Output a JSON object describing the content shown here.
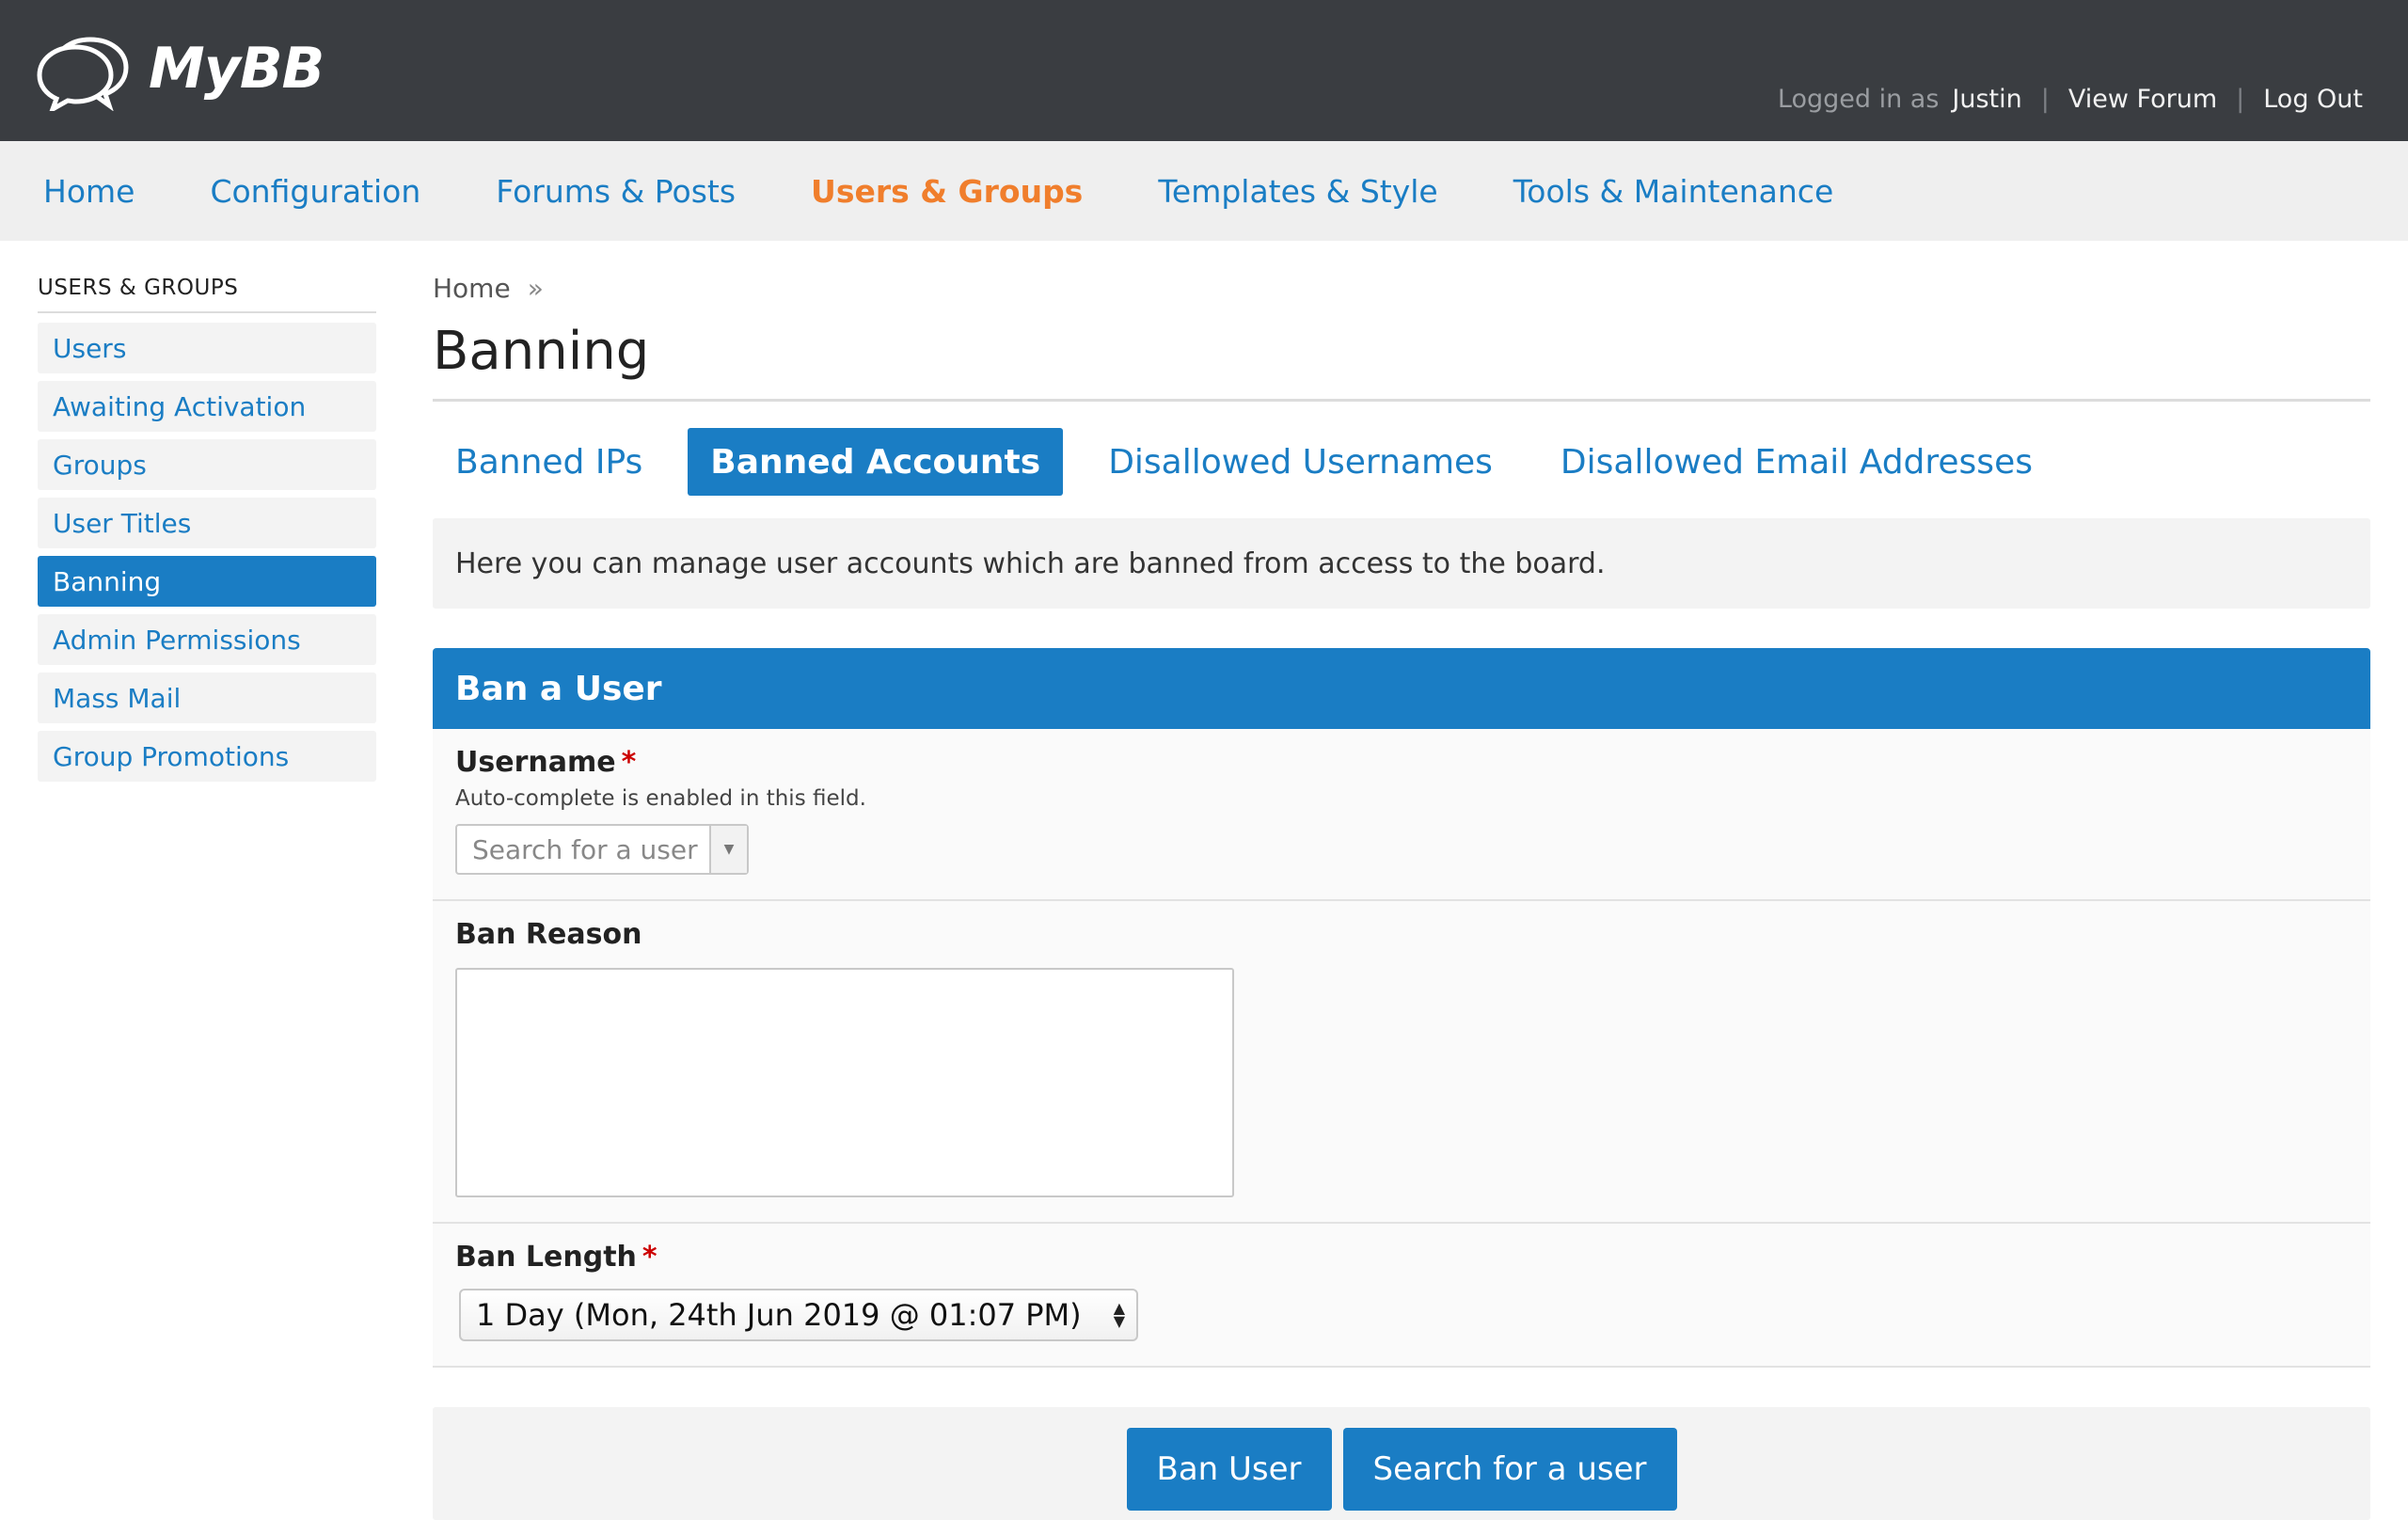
{
  "app": {
    "logo_text": "MyBB"
  },
  "header": {
    "logged_in_label": "Logged in as",
    "username": "Justin",
    "view_forum": "View Forum",
    "log_out": "Log Out"
  },
  "topnav": {
    "items": [
      {
        "label": "Home",
        "active": false
      },
      {
        "label": "Configuration",
        "active": false
      },
      {
        "label": "Forums & Posts",
        "active": false
      },
      {
        "label": "Users & Groups",
        "active": true
      },
      {
        "label": "Templates & Style",
        "active": false
      },
      {
        "label": "Tools & Maintenance",
        "active": false
      }
    ]
  },
  "sidebar": {
    "title": "USERS & GROUPS",
    "items": [
      {
        "label": "Users"
      },
      {
        "label": "Awaiting Activation"
      },
      {
        "label": "Groups"
      },
      {
        "label": "User Titles"
      },
      {
        "label": "Banning",
        "active": true
      },
      {
        "label": "Admin Permissions"
      },
      {
        "label": "Mass Mail"
      },
      {
        "label": "Group Promotions"
      }
    ]
  },
  "main": {
    "breadcrumb": {
      "home": "Home",
      "separator": "»"
    },
    "title": "Banning",
    "tabs": [
      {
        "label": "Banned IPs"
      },
      {
        "label": "Banned Accounts",
        "active": true
      },
      {
        "label": "Disallowed Usernames"
      },
      {
        "label": "Disallowed Email Addresses"
      }
    ],
    "notice": "Here you can manage user accounts which are banned from access to the board."
  },
  "form": {
    "header": "Ban a User",
    "username": {
      "label": "Username",
      "required_mark": "*",
      "description": "Auto-complete is enabled in this field.",
      "placeholder": "Search for a user"
    },
    "reason": {
      "label": "Ban Reason",
      "value": ""
    },
    "length": {
      "label": "Ban Length",
      "required_mark": "*",
      "selected": "1 Day (Mon, 24th Jun 2019 @ 01:07 PM)"
    },
    "buttons": {
      "submit": "Ban User",
      "search": "Search for a user"
    }
  },
  "colors": {
    "header_bg": "#3a3d41",
    "accent_blue": "#1a7dc4",
    "active_nav": "#f07e2c",
    "required": "#cc0000"
  }
}
